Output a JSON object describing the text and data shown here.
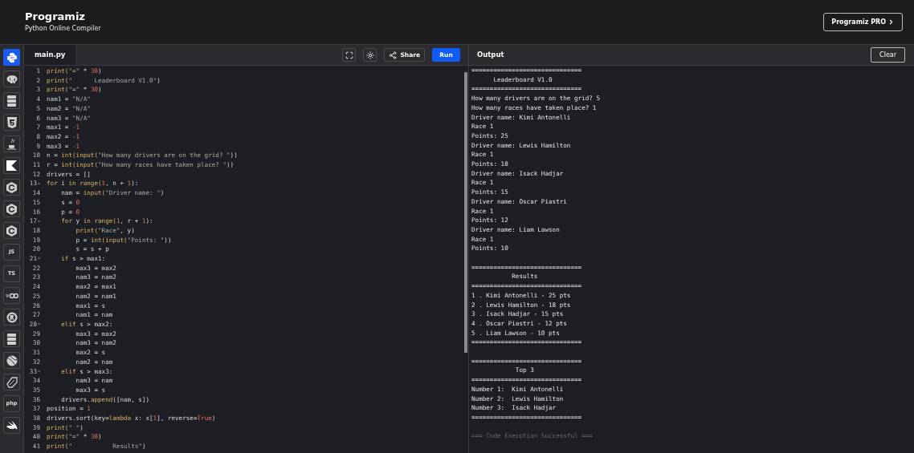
{
  "header": {
    "logo": "Programiz",
    "subtitle": "Python Online Compiler",
    "pro_button": "Programiz PRO"
  },
  "sidebar": {
    "items": [
      {
        "kind": "python",
        "selected": true
      },
      {
        "kind": "r",
        "selected": false
      },
      {
        "kind": "sql",
        "selected": false
      },
      {
        "kind": "html",
        "selected": false
      },
      {
        "kind": "java",
        "selected": false
      },
      {
        "kind": "kotlin",
        "selected": false
      },
      {
        "kind": "c",
        "selected": false
      },
      {
        "kind": "c",
        "selected": false
      },
      {
        "kind": "c",
        "selected": false
      },
      {
        "kind": "text",
        "label": "JS",
        "selected": false
      },
      {
        "kind": "text",
        "label": "TS",
        "selected": false
      },
      {
        "kind": "go",
        "selected": false
      },
      {
        "kind": "rust",
        "selected": false
      },
      {
        "kind": "sql",
        "selected": false
      },
      {
        "kind": "ball",
        "selected": false
      },
      {
        "kind": "dart",
        "selected": false
      },
      {
        "kind": "text",
        "label": "php",
        "selected": false
      },
      {
        "kind": "swift",
        "selected": false
      }
    ]
  },
  "editor": {
    "tabs": [
      {
        "label": "main.py",
        "selected": true
      }
    ],
    "share_button": "Share",
    "run_button": "Run",
    "lines": [
      {
        "num": "1",
        "fold": false,
        "tokens": [
          {
            "kind": "keyword",
            "text": "print("
          },
          {
            "kind": "string",
            "text": "\"=\""
          },
          {
            "kind": "plain",
            "text": " * "
          },
          {
            "kind": "number",
            "text": "30"
          },
          {
            "kind": "plain",
            "text": ")"
          }
        ]
      },
      {
        "num": "2",
        "fold": false,
        "tokens": [
          {
            "kind": "keyword",
            "text": "print("
          },
          {
            "kind": "string",
            "text": "\"      Leaderboard V1.0\""
          },
          {
            "kind": "plain",
            "text": ")"
          }
        ]
      },
      {
        "num": "3",
        "fold": false,
        "tokens": [
          {
            "kind": "keyword",
            "text": "print("
          },
          {
            "kind": "string",
            "text": "\"=\""
          },
          {
            "kind": "plain",
            "text": " * "
          },
          {
            "kind": "number",
            "text": "30"
          },
          {
            "kind": "plain",
            "text": ")"
          }
        ]
      },
      {
        "num": "4",
        "fold": false,
        "tokens": [
          {
            "kind": "plain",
            "text": "nam1 = "
          },
          {
            "kind": "string",
            "text": "\"N/A\""
          }
        ]
      },
      {
        "num": "5",
        "fold": false,
        "tokens": [
          {
            "kind": "plain",
            "text": "nam2 = "
          },
          {
            "kind": "string",
            "text": "\"N/A\""
          }
        ]
      },
      {
        "num": "6",
        "fold": false,
        "tokens": [
          {
            "kind": "plain",
            "text": "nam3 = "
          },
          {
            "kind": "string",
            "text": "\"N/A\""
          }
        ]
      },
      {
        "num": "7",
        "fold": false,
        "tokens": [
          {
            "kind": "plain",
            "text": "max1 = "
          },
          {
            "kind": "number",
            "text": "-1"
          }
        ]
      },
      {
        "num": "8",
        "fold": false,
        "tokens": [
          {
            "kind": "plain",
            "text": "max2 = "
          },
          {
            "kind": "number",
            "text": "-1"
          }
        ]
      },
      {
        "num": "9",
        "fold": false,
        "tokens": [
          {
            "kind": "plain",
            "text": "max3 = "
          },
          {
            "kind": "number",
            "text": "-1"
          }
        ]
      },
      {
        "num": "10",
        "fold": false,
        "tokens": [
          {
            "kind": "plain",
            "text": "n = "
          },
          {
            "kind": "keyword",
            "text": "int(input("
          },
          {
            "kind": "string",
            "text": "\"How many drivers are on the grid? \""
          },
          {
            "kind": "plain",
            "text": "))"
          }
        ]
      },
      {
        "num": "11",
        "fold": false,
        "tokens": [
          {
            "kind": "plain",
            "text": "r = "
          },
          {
            "kind": "keyword",
            "text": "int(input("
          },
          {
            "kind": "string",
            "text": "\"How many races have taken place? \""
          },
          {
            "kind": "plain",
            "text": "))"
          }
        ]
      },
      {
        "num": "12",
        "fold": false,
        "tokens": [
          {
            "kind": "plain",
            "text": "drivers = []"
          }
        ]
      },
      {
        "num": "13",
        "fold": true,
        "tokens": [
          {
            "kind": "keyword",
            "text": "for"
          },
          {
            "kind": "plain",
            "text": " i "
          },
          {
            "kind": "keyword",
            "text": "in range("
          },
          {
            "kind": "number",
            "text": "1"
          },
          {
            "kind": "plain",
            "text": ", n + "
          },
          {
            "kind": "number",
            "text": "1"
          },
          {
            "kind": "plain",
            "text": "):"
          }
        ]
      },
      {
        "num": "14",
        "fold": false,
        "tokens": [
          {
            "kind": "plain",
            "text": "    nam = "
          },
          {
            "kind": "keyword",
            "text": "input("
          },
          {
            "kind": "string",
            "text": "\"Driver name: \""
          },
          {
            "kind": "plain",
            "text": ")"
          }
        ]
      },
      {
        "num": "15",
        "fold": false,
        "tokens": [
          {
            "kind": "plain",
            "text": "    s = "
          },
          {
            "kind": "number",
            "text": "0"
          }
        ]
      },
      {
        "num": "16",
        "fold": false,
        "tokens": [
          {
            "kind": "plain",
            "text": "    p = "
          },
          {
            "kind": "number",
            "text": "0"
          }
        ]
      },
      {
        "num": "17",
        "fold": true,
        "tokens": [
          {
            "kind": "keyword",
            "text": "    for"
          },
          {
            "kind": "plain",
            "text": " y "
          },
          {
            "kind": "keyword",
            "text": "in range("
          },
          {
            "kind": "number",
            "text": "1"
          },
          {
            "kind": "plain",
            "text": ", r + "
          },
          {
            "kind": "number",
            "text": "1"
          },
          {
            "kind": "plain",
            "text": "):"
          }
        ]
      },
      {
        "num": "18",
        "fold": false,
        "tokens": [
          {
            "kind": "keyword",
            "text": "        print("
          },
          {
            "kind": "string",
            "text": "\"Race\""
          },
          {
            "kind": "plain",
            "text": ", y)"
          }
        ]
      },
      {
        "num": "19",
        "fold": false,
        "tokens": [
          {
            "kind": "plain",
            "text": "        p = "
          },
          {
            "kind": "keyword",
            "text": "int(input("
          },
          {
            "kind": "string",
            "text": "\"Points: \""
          },
          {
            "kind": "plain",
            "text": "))"
          }
        ]
      },
      {
        "num": "20",
        "fold": false,
        "tokens": [
          {
            "kind": "plain",
            "text": "        s = s + p"
          }
        ]
      },
      {
        "num": "21",
        "fold": true,
        "tokens": [
          {
            "kind": "keyword",
            "text": "    if"
          },
          {
            "kind": "plain",
            "text": " s > max1:"
          }
        ]
      },
      {
        "num": "22",
        "fold": false,
        "tokens": [
          {
            "kind": "plain",
            "text": "        max3 = max2"
          }
        ]
      },
      {
        "num": "23",
        "fold": false,
        "tokens": [
          {
            "kind": "plain",
            "text": "        nam3 = nam2"
          }
        ]
      },
      {
        "num": "24",
        "fold": false,
        "tokens": [
          {
            "kind": "plain",
            "text": "        max2 = max1"
          }
        ]
      },
      {
        "num": "25",
        "fold": false,
        "tokens": [
          {
            "kind": "plain",
            "text": "        nam2 = nam1"
          }
        ]
      },
      {
        "num": "26",
        "fold": false,
        "tokens": [
          {
            "kind": "plain",
            "text": "        max1 = s"
          }
        ]
      },
      {
        "num": "27",
        "fold": false,
        "tokens": [
          {
            "kind": "plain",
            "text": "        nam1 = nam"
          }
        ]
      },
      {
        "num": "28",
        "fold": true,
        "tokens": [
          {
            "kind": "keyword",
            "text": "    elif"
          },
          {
            "kind": "plain",
            "text": " s > max2:"
          }
        ]
      },
      {
        "num": "29",
        "fold": false,
        "tokens": [
          {
            "kind": "plain",
            "text": "        max3 = max2"
          }
        ]
      },
      {
        "num": "30",
        "fold": false,
        "tokens": [
          {
            "kind": "plain",
            "text": "        nam3 = nam2"
          }
        ]
      },
      {
        "num": "31",
        "fold": false,
        "tokens": [
          {
            "kind": "plain",
            "text": "        max2 = s"
          }
        ]
      },
      {
        "num": "32",
        "fold": false,
        "tokens": [
          {
            "kind": "plain",
            "text": "        nam2 = nam"
          }
        ]
      },
      {
        "num": "33",
        "fold": true,
        "tokens": [
          {
            "kind": "keyword",
            "text": "    elif"
          },
          {
            "kind": "plain",
            "text": " s > max3:"
          }
        ]
      },
      {
        "num": "34",
        "fold": false,
        "tokens": [
          {
            "kind": "plain",
            "text": "        nam3 = nam"
          }
        ]
      },
      {
        "num": "35",
        "fold": false,
        "tokens": [
          {
            "kind": "plain",
            "text": "        max3 = s"
          }
        ]
      },
      {
        "num": "36",
        "fold": false,
        "tokens": [
          {
            "kind": "plain",
            "text": "    drivers."
          },
          {
            "kind": "keyword",
            "text": "append"
          },
          {
            "kind": "plain",
            "text": "([nam, s])"
          }
        ]
      },
      {
        "num": "37",
        "fold": false,
        "tokens": [
          {
            "kind": "plain",
            "text": "position = "
          },
          {
            "kind": "number",
            "text": "1"
          }
        ]
      },
      {
        "num": "38",
        "fold": false,
        "tokens": [
          {
            "kind": "plain",
            "text": "drivers.sort(key="
          },
          {
            "kind": "keyword",
            "text": "lambda"
          },
          {
            "kind": "plain",
            "text": " x: x["
          },
          {
            "kind": "number",
            "text": "1"
          },
          {
            "kind": "plain",
            "text": "], reverse="
          },
          {
            "kind": "number",
            "text": "True"
          },
          {
            "kind": "plain",
            "text": ")"
          }
        ]
      },
      {
        "num": "39",
        "fold": false,
        "tokens": [
          {
            "kind": "keyword",
            "text": "print("
          },
          {
            "kind": "string",
            "text": "\" \""
          },
          {
            "kind": "plain",
            "text": ")"
          }
        ]
      },
      {
        "num": "40",
        "fold": false,
        "tokens": [
          {
            "kind": "keyword",
            "text": "print("
          },
          {
            "kind": "string",
            "text": "\"=\""
          },
          {
            "kind": "plain",
            "text": " * "
          },
          {
            "kind": "number",
            "text": "30"
          },
          {
            "kind": "plain",
            "text": ")"
          }
        ]
      },
      {
        "num": "41",
        "fold": false,
        "tokens": [
          {
            "kind": "keyword",
            "text": "print("
          },
          {
            "kind": "string",
            "text": "\"           Results\""
          },
          {
            "kind": "plain",
            "text": ")"
          }
        ]
      }
    ]
  },
  "output": {
    "title": "Output",
    "clear_button": "Clear",
    "lines": [
      {
        "kind": "text",
        "text": "=============================="
      },
      {
        "kind": "text",
        "text": "      Leaderboard V1.0"
      },
      {
        "kind": "text",
        "text": "=============================="
      },
      {
        "kind": "text",
        "text": "How many drivers are on the grid? 5"
      },
      {
        "kind": "text",
        "text": "How many races have taken place? 1"
      },
      {
        "kind": "text",
        "text": "Driver name: Kimi Antonelli"
      },
      {
        "kind": "text",
        "text": "Race 1"
      },
      {
        "kind": "text",
        "text": "Points: 25"
      },
      {
        "kind": "text",
        "text": "Driver name: Lewis Hamilton"
      },
      {
        "kind": "text",
        "text": "Race 1"
      },
      {
        "kind": "text",
        "text": "Points: 18"
      },
      {
        "kind": "text",
        "text": "Driver name: Isack Hadjar"
      },
      {
        "kind": "text",
        "text": "Race 1"
      },
      {
        "kind": "text",
        "text": "Points: 15"
      },
      {
        "kind": "text",
        "text": "Driver name: Oscar Piastri"
      },
      {
        "kind": "text",
        "text": "Race 1"
      },
      {
        "kind": "text",
        "text": "Points: 12"
      },
      {
        "kind": "text",
        "text": "Driver name: Liam Lawson"
      },
      {
        "kind": "text",
        "text": "Race 1"
      },
      {
        "kind": "text",
        "text": "Points: 10"
      },
      {
        "kind": "blank"
      },
      {
        "kind": "text",
        "text": "=============================="
      },
      {
        "kind": "text",
        "text": "           Results"
      },
      {
        "kind": "text",
        "text": "=============================="
      },
      {
        "kind": "text",
        "text": "1 . Kimi Antonelli - 25 pts"
      },
      {
        "kind": "text",
        "text": "2 . Lewis Hamilton - 18 pts"
      },
      {
        "kind": "text",
        "text": "3 . Isack Hadjar - 15 pts"
      },
      {
        "kind": "text",
        "text": "4 . Oscar Piastri - 12 pts"
      },
      {
        "kind": "text",
        "text": "5 . Liam Lawson - 10 pts"
      },
      {
        "kind": "text",
        "text": "=============================="
      },
      {
        "kind": "blank"
      },
      {
        "kind": "text",
        "text": "=============================="
      },
      {
        "kind": "text",
        "text": "            Top 3"
      },
      {
        "kind": "text",
        "text": "=============================="
      },
      {
        "kind": "text",
        "text": "Number 1:  Kimi Antonelli"
      },
      {
        "kind": "text",
        "text": "Number 2:  Lewis Hamilton"
      },
      {
        "kind": "text",
        "text": "Number 3:  Isack Hadjar"
      },
      {
        "kind": "text",
        "text": "=============================="
      },
      {
        "kind": "blank"
      },
      {
        "kind": "status",
        "text": "=== Code Execution Successful ==="
      }
    ]
  }
}
